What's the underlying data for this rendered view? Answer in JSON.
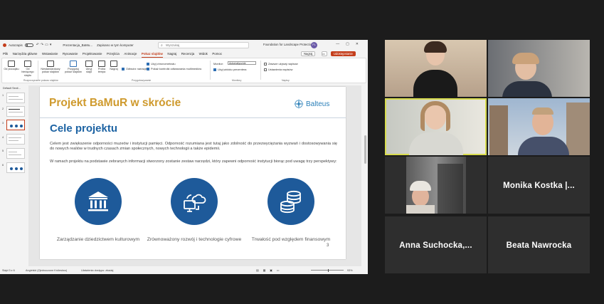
{
  "ppt": {
    "titlebar": {
      "autosave_label": "Autozapis",
      "filename": "Prezentacja_BaMu...",
      "saved_state": "Zapisano w tym komputer",
      "search_placeholder": "Wyszukaj",
      "user": "Foundation for Landscape Protection",
      "user_initials": "FL"
    },
    "menu": [
      "Plik",
      "Narzędzia główne",
      "Wstawianie",
      "Rysowanie",
      "Projektowanie",
      "Przejścia",
      "Animacje",
      "Pokaz slajdów",
      "Nagraj",
      "Recenzja",
      "Widok",
      "Pomoc"
    ],
    "menu_active_index": 7,
    "record_btn": "Nagraj",
    "share_btn": "Udostępnianie",
    "ribbon": {
      "buttons": [
        {
          "label": "Od początku"
        },
        {
          "label": "Od bieżącego slajdu"
        },
        {
          "label": "Niestandardowy pokaz slajdów"
        },
        {
          "label": "Przygotuj pokaz slajdów"
        },
        {
          "label": "Ukryj slajd"
        },
        {
          "label": "Próba tempa"
        },
        {
          "label": "Nagraj"
        }
      ],
      "checks": [
        {
          "label": "Odtwórz narracje",
          "on": true
        },
        {
          "label": "Użyj chronometrażu",
          "on": true
        },
        {
          "label": "Pokaż kontrolki odtwarzania multimediów",
          "on": true
        },
        {
          "label": "Użyj widoku prezentera",
          "on": true
        },
        {
          "label": "Zawsze używaj napisów",
          "on": false
        }
      ],
      "monitor_label": "Monitor:",
      "monitor_value": "Automatycznie",
      "subtitles_label": "Ustawienia napisów",
      "groups": [
        "Rozpoczynanie pokazu slajdów",
        "Przygotowywanie",
        "Monitory",
        "Napisy"
      ]
    },
    "thumbs": {
      "section_label": "Default Secti...",
      "slides": [
        "1",
        "2",
        "3",
        "4",
        "5",
        "6"
      ],
      "selected_index": 2
    },
    "slide": {
      "title": "Projekt BaMuR w skrócie",
      "logo_text": "Balteus",
      "heading": "Cele projektu",
      "para1": "Celem jest zwiększenie odporności muzeów i instytucji pamięci. Odporność rozumiana jest tutaj jako zdolność do przezwyciężania wyzwań i dostosowywania się do nowych realiów w trudnych czasach zmian społecznych, nowych technologii a także epidemii.",
      "para2": "W ramach projektu na podstawie zebranych informacji stworzony zostanie zestaw narzędzi, który zapewni odporność instytucji biorąc pod uwagę trzy perspektywy:",
      "pillars": [
        {
          "label": "Zarządzanie dziedzictwem kulturowym",
          "icon": "museum-icon"
        },
        {
          "label": "Zrównoważony rozwój i technologie cyfrowe",
          "icon": "cloud-computer-icon"
        },
        {
          "label": "Trwałość pod względem finansowym",
          "icon": "coins-icon"
        }
      ],
      "page_number": "3"
    },
    "status": {
      "slide_counter": "Slajd 3 z 6",
      "language": "Angielski (Zjednoczone Królestwo)",
      "accessibility": "Ułatwienia dostępu: zbadaj",
      "zoom": "93%"
    }
  },
  "participants": [
    {
      "id": "p1",
      "name": ""
    },
    {
      "id": "p2",
      "name": ""
    },
    {
      "id": "p3",
      "name": "",
      "active": true
    },
    {
      "id": "p4",
      "name": ""
    },
    {
      "id": "p5",
      "name": ""
    },
    {
      "id": "p6",
      "name": "Monika Kostka |..."
    },
    {
      "id": "p7",
      "name": "Anna Suchocka,..."
    },
    {
      "id": "p8",
      "name": "Beata Nawrocka"
    }
  ]
}
